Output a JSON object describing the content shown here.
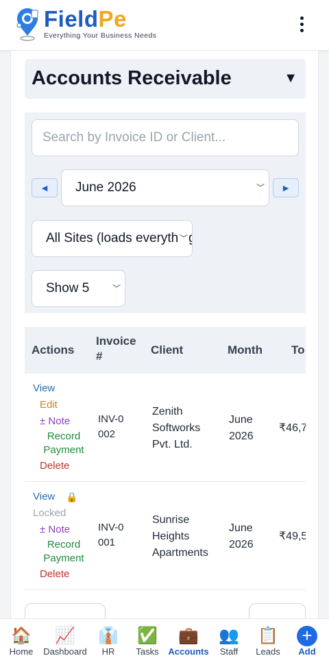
{
  "brand": {
    "name_part1": "Field",
    "name_part2": "Pe",
    "tagline": "Everything Your Business Needs"
  },
  "page": {
    "title": "Accounts Receivable",
    "toggle": "▼"
  },
  "filters": {
    "search_placeholder": "Search by Invoice ID or Client...",
    "prev": "◄",
    "next": "►",
    "month": "June 2026",
    "site": "All Sites (loads everything)",
    "page_size": "Show 5"
  },
  "table": {
    "headers": [
      "Actions",
      "Invoice #",
      "Client",
      "Month",
      "To"
    ],
    "rows": [
      {
        "actions": {
          "view": "View",
          "edit": "Edit",
          "note": "± Note",
          "record": "Record Payment",
          "delete": "Delete"
        },
        "invoice": "INV-0002",
        "client": "Zenith Softworks Pvt. Ltd.",
        "month": "June 2026",
        "total": "₹46,7"
      },
      {
        "actions": {
          "view": "View",
          "lock_icon": "🔒",
          "locked": "Locked",
          "note": "± Note",
          "record": "Record Payment",
          "delete": "Delete"
        },
        "invoice": "INV-0001",
        "client": "Sunrise Heights Apartments",
        "month": "June 2026",
        "total": "₹49,5"
      }
    ]
  },
  "bottom_nav": [
    {
      "icon": "🏠",
      "label": "Home"
    },
    {
      "icon": "📈",
      "label": "Dashboard"
    },
    {
      "icon": "👔",
      "label": "HR"
    },
    {
      "icon": "✅",
      "label": "Tasks"
    },
    {
      "icon": "💼",
      "label": "Accounts",
      "active": true
    },
    {
      "icon": "👥",
      "label": "Staff"
    },
    {
      "icon": "📋",
      "label": "Leads"
    },
    {
      "icon": "+",
      "label": "Add"
    }
  ],
  "colors": {
    "brand_blue": "#1e5bbf",
    "brand_orange": "#f2a51f",
    "link_blue": "#2b6cb0",
    "edit_orange": "#c98512",
    "note_purple": "#8b3fbf",
    "record_green": "#1f8a3b",
    "delete_red": "#c53030"
  }
}
